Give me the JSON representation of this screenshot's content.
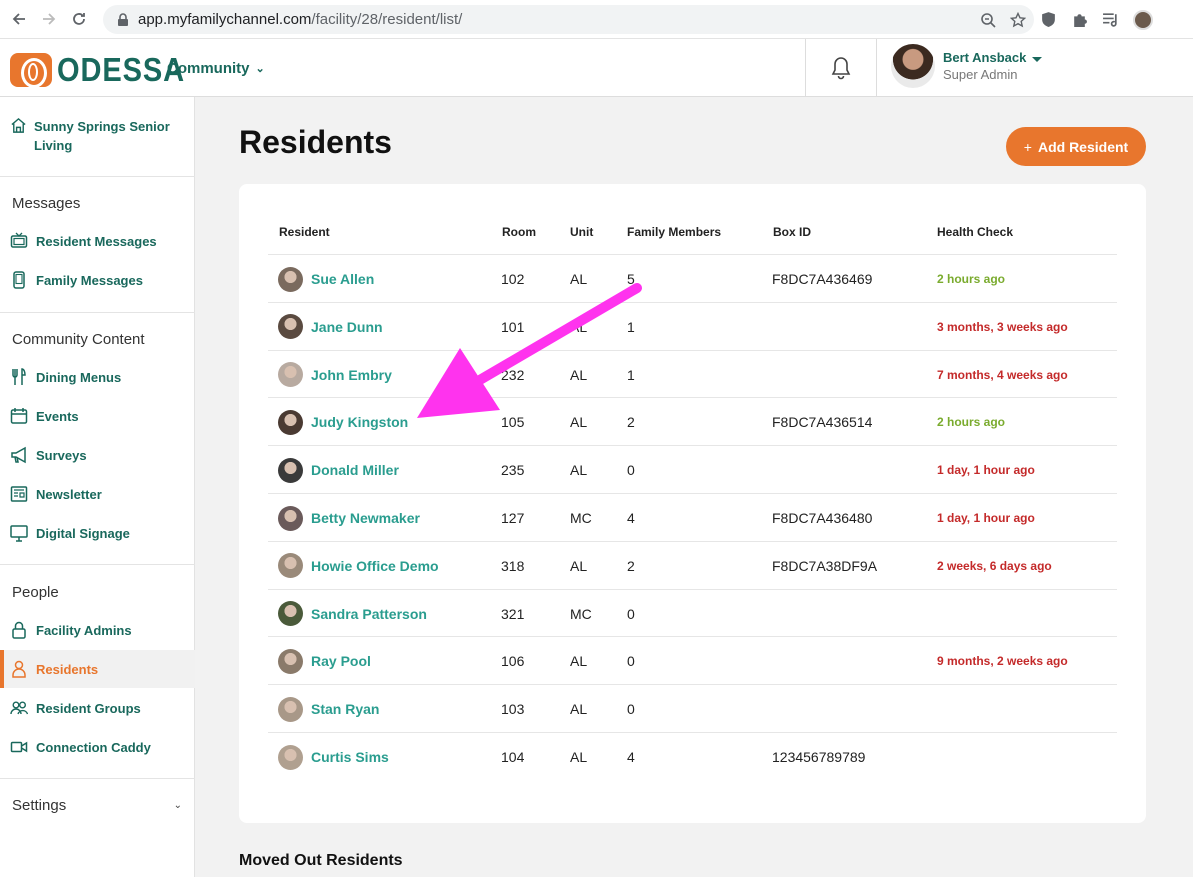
{
  "browser": {
    "url_host": "app.myfamilychannel.com",
    "url_path": "/facility/28/resident/list/"
  },
  "header": {
    "logo_text": "ODESSA",
    "community_label": "Community",
    "user_name": "Bert Ansback",
    "user_role": "Super Admin"
  },
  "sidebar": {
    "facility_name": "Sunny Springs Senior Living",
    "sections": [
      {
        "title": "Messages"
      },
      {
        "title": "Community Content"
      },
      {
        "title": "People"
      }
    ],
    "items": [
      {
        "label": "Resident Messages",
        "icon": "tv-icon"
      },
      {
        "label": "Family Messages",
        "icon": "phone-icon"
      },
      {
        "label": "Dining Menus",
        "icon": "utensils-icon"
      },
      {
        "label": "Events",
        "icon": "calendar-icon"
      },
      {
        "label": "Surveys",
        "icon": "megaphone-icon"
      },
      {
        "label": "Newsletter",
        "icon": "newspaper-icon"
      },
      {
        "label": "Digital Signage",
        "icon": "monitor-icon"
      },
      {
        "label": "Facility Admins",
        "icon": "lock-icon"
      },
      {
        "label": "Residents",
        "icon": "person-icon",
        "active": true
      },
      {
        "label": "Resident Groups",
        "icon": "group-icon"
      },
      {
        "label": "Connection Caddy",
        "icon": "video-icon"
      }
    ],
    "settings_label": "Settings"
  },
  "main": {
    "title": "Residents",
    "add_button": "Add Resident",
    "add_button_plus": "+",
    "columns": [
      "Resident",
      "Room",
      "Unit",
      "Family Members",
      "Box ID",
      "Health Check"
    ],
    "rows": [
      {
        "name": "Sue Allen",
        "room": "102",
        "unit": "AL",
        "family": "5",
        "box": "F8DC7A436469",
        "health": "2 hours ago",
        "status": "ok",
        "avatar": "#7a6a5e"
      },
      {
        "name": "Jane Dunn",
        "room": "101",
        "unit": "AL",
        "family": "1",
        "box": "",
        "health": "3 months, 3 weeks ago",
        "status": "old",
        "avatar": "#5a4a40"
      },
      {
        "name": "John Embry",
        "room": "232",
        "unit": "AL",
        "family": "1",
        "box": "",
        "health": "7 months, 4 weeks ago",
        "status": "old",
        "avatar": "#b8aaa0"
      },
      {
        "name": "Judy Kingston",
        "room": "105",
        "unit": "AL",
        "family": "2",
        "box": "F8DC7A436514",
        "health": "2 hours ago",
        "status": "ok",
        "avatar": "#4a3a32"
      },
      {
        "name": "Donald Miller",
        "room": "235",
        "unit": "AL",
        "family": "0",
        "box": "",
        "health": "1 day, 1 hour ago",
        "status": "old",
        "avatar": "#3a3a3a"
      },
      {
        "name": "Betty Newmaker",
        "room": "127",
        "unit": "MC",
        "family": "4",
        "box": "F8DC7A436480",
        "health": "1 day, 1 hour ago",
        "status": "old",
        "avatar": "#6a5a5a"
      },
      {
        "name": "Howie Office Demo",
        "room": "318",
        "unit": "AL",
        "family": "2",
        "box": "F8DC7A38DF9A",
        "health": "2 weeks, 6 days ago",
        "status": "old",
        "avatar": "#9a8a7a"
      },
      {
        "name": "Sandra Patterson",
        "room": "321",
        "unit": "MC",
        "family": "0",
        "box": "",
        "health": "",
        "status": "",
        "avatar": "#4a5a3a"
      },
      {
        "name": "Ray Pool",
        "room": "106",
        "unit": "AL",
        "family": "0",
        "box": "",
        "health": "9 months, 2 weeks ago",
        "status": "old",
        "avatar": "#8a7a6a"
      },
      {
        "name": "Stan Ryan",
        "room": "103",
        "unit": "AL",
        "family": "0",
        "box": "",
        "health": "",
        "status": "",
        "avatar": "#a89888"
      },
      {
        "name": "Curtis Sims",
        "room": "104",
        "unit": "AL",
        "family": "4",
        "box": "123456789789",
        "health": "",
        "status": "",
        "avatar": "#b0a090"
      }
    ],
    "moved_out_title": "Moved Out Residents"
  },
  "colors": {
    "brand_teal": "#19685c",
    "accent_orange": "#e8762d",
    "link_teal": "#2a9d8f",
    "health_ok": "#7aab2e",
    "health_old": "#c42a2a",
    "annotation_arrow": "#ff33ee"
  }
}
